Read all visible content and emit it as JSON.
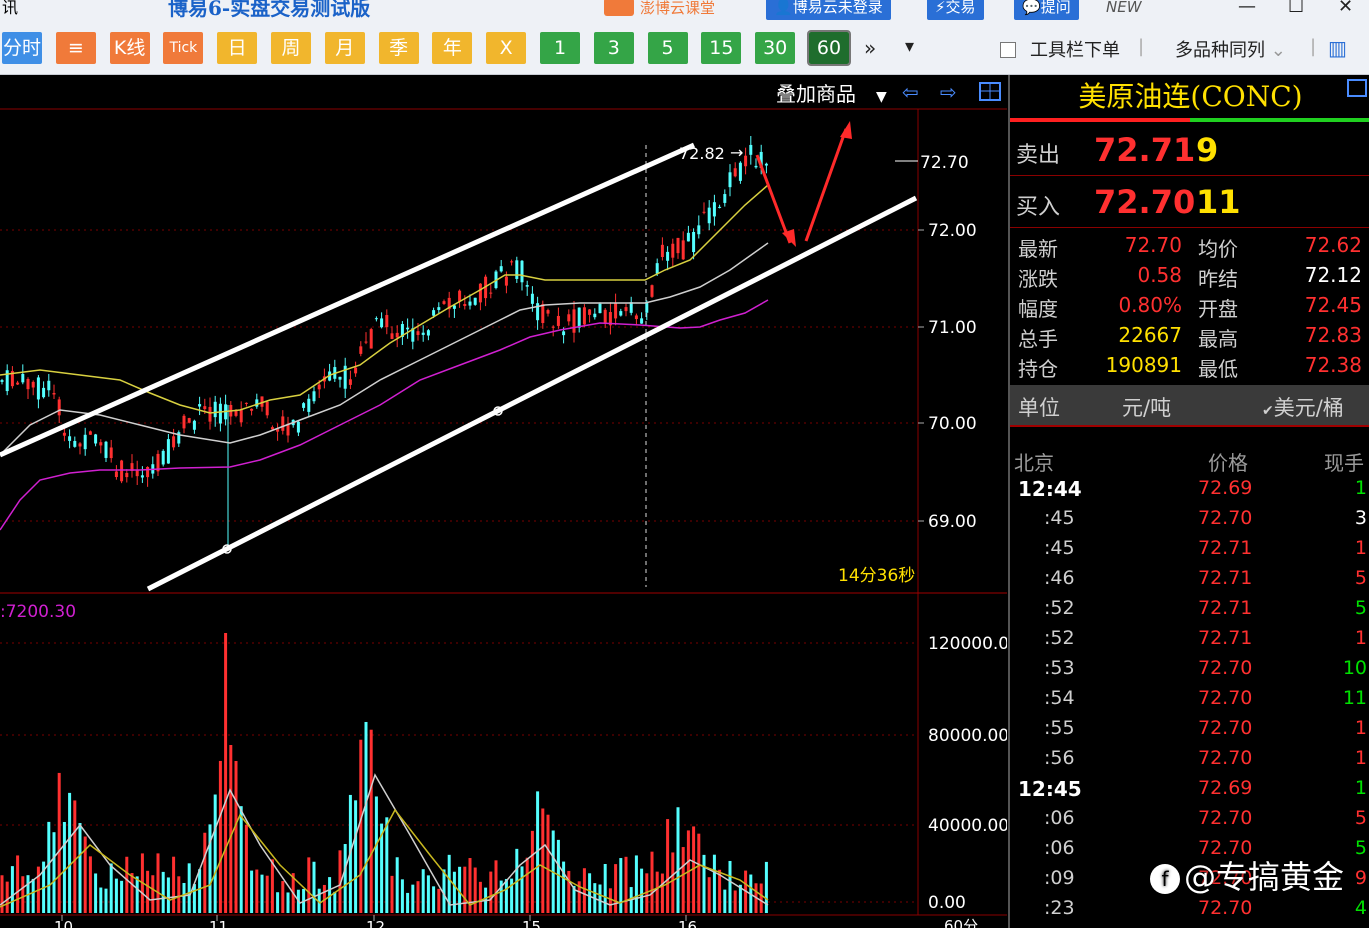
{
  "titlebar": {
    "left_char": "讯",
    "app_title": "博易6-实盘交易测试版",
    "course": "澎博云课堂",
    "login": "博易云未登录",
    "trade": "交易",
    "ask": "提问",
    "new": "NEW"
  },
  "toolbar": {
    "buttons": [
      "分时",
      "≡",
      "K线",
      "Tick",
      "日",
      "周",
      "月",
      "季",
      "年",
      "X",
      "1",
      "3",
      "5",
      "15",
      "30",
      "60"
    ],
    "more": "»",
    "dropdown": "▾",
    "toolbar_order": "工具栏下单",
    "multi_same": "多品种同列",
    "layout_icon": "layout-icon"
  },
  "chart": {
    "overlay_label": "叠加商品",
    "high_marker": "72.82",
    "last_label": "72.70",
    "countdown": "14分36秒",
    "volume_label": ":7200.30",
    "price_ticks": [
      "72.00",
      "71.00",
      "70.00",
      "69.00"
    ],
    "vol_ticks": [
      "120000.0",
      "80000.00",
      "40000.00",
      "0.00"
    ],
    "x_ticks": [
      "10",
      "11",
      "12",
      "15",
      "16"
    ],
    "x_unit": "60分"
  },
  "chart_data": {
    "type": "candlestick",
    "title": "",
    "ylim": [
      68.3,
      72.95
    ],
    "period": "60分",
    "vol_ylim": [
      0,
      130000
    ]
  },
  "quote": {
    "name": "美原油连(CONC)",
    "sell_label": "卖出",
    "sell_price": "72.71",
    "sell_qty": "9",
    "buy_label": "买入",
    "buy_price": "72.70",
    "buy_qty": "11",
    "stats": [
      {
        "l1": "最新",
        "v1": "72.70",
        "l2": "均价",
        "v2": "72.62"
      },
      {
        "l1": "涨跌",
        "v1": "0.58",
        "l2": "昨结",
        "v2": "72.12"
      },
      {
        "l1": "幅度",
        "v1": "0.80%",
        "l2": "开盘",
        "v2": "72.45"
      },
      {
        "l1": "总手",
        "v1": "22667",
        "l2": "最高",
        "v2": "72.83"
      },
      {
        "l1": "持仓",
        "v1": "190891",
        "l2": "最低",
        "v2": "72.38"
      }
    ],
    "unit_label": "单位",
    "unit_value": "元/吨",
    "unit_alt": "美元/桶",
    "ticks_header": {
      "city": "北京",
      "price": "价格",
      "qty": "现手"
    },
    "ticks": [
      {
        "t": "12:44",
        "p": "72.69",
        "q": "1",
        "big": true,
        "pc": "red",
        "qc": "grn"
      },
      {
        "t": ":45",
        "p": "72.70",
        "q": "3",
        "big": false,
        "pc": "red",
        "qc": "wht"
      },
      {
        "t": ":45",
        "p": "72.71",
        "q": "1",
        "big": false,
        "pc": "red",
        "qc": "red"
      },
      {
        "t": ":46",
        "p": "72.71",
        "q": "5",
        "big": false,
        "pc": "red",
        "qc": "red"
      },
      {
        "t": ":52",
        "p": "72.71",
        "q": "5",
        "big": false,
        "pc": "red",
        "qc": "grn"
      },
      {
        "t": ":52",
        "p": "72.71",
        "q": "1",
        "big": false,
        "pc": "red",
        "qc": "red"
      },
      {
        "t": ":53",
        "p": "72.70",
        "q": "10",
        "big": false,
        "pc": "red",
        "qc": "grn"
      },
      {
        "t": ":54",
        "p": "72.70",
        "q": "11",
        "big": false,
        "pc": "red",
        "qc": "grn"
      },
      {
        "t": ":55",
        "p": "72.70",
        "q": "1",
        "big": false,
        "pc": "red",
        "qc": "red"
      },
      {
        "t": ":56",
        "p": "72.70",
        "q": "1",
        "big": false,
        "pc": "red",
        "qc": "red"
      },
      {
        "t": "12:45",
        "p": "72.69",
        "q": "1",
        "big": true,
        "pc": "red",
        "qc": "grn"
      },
      {
        "t": ":06",
        "p": "72.70",
        "q": "5",
        "big": false,
        "pc": "red",
        "qc": "red"
      },
      {
        "t": ":06",
        "p": "72.70",
        "q": "5",
        "big": false,
        "pc": "red",
        "qc": "grn"
      },
      {
        "t": ":09",
        "p": "72.70",
        "q": "9",
        "big": false,
        "pc": "red",
        "qc": "red"
      },
      {
        "t": ":23",
        "p": "72.70",
        "q": "4",
        "big": false,
        "pc": "red",
        "qc": "grn"
      }
    ]
  },
  "watermark": "@专搞黄金",
  "colors": {
    "up": "#ff3030",
    "down": "#54ffff",
    "ma5": "#d8d040",
    "ma10": "#cfcfcf",
    "ma20": "#d020d0",
    "grid": "#8a0000"
  }
}
